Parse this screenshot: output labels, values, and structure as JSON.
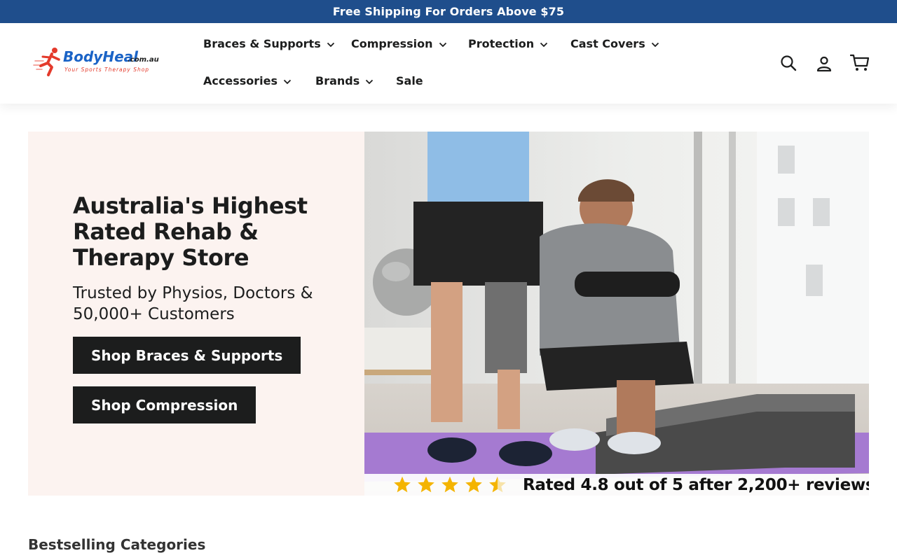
{
  "announcement": {
    "text": "Free Shipping For Orders Above $75"
  },
  "brand": {
    "name_main": "BodyHeal",
    "name_suffix": ".com.au",
    "tagline": "Your Sports Therapy Shop"
  },
  "nav": {
    "items": [
      {
        "label": "Braces & Supports",
        "has_dropdown": true
      },
      {
        "label": "Compression",
        "has_dropdown": true
      },
      {
        "label": "Protection",
        "has_dropdown": true
      },
      {
        "label": "Cast Covers",
        "has_dropdown": true
      },
      {
        "label": "Accessories",
        "has_dropdown": true
      },
      {
        "label": "Brands",
        "has_dropdown": true
      },
      {
        "label": "Sale",
        "has_dropdown": false
      }
    ]
  },
  "header_icons": [
    "search-icon",
    "account-icon",
    "cart-icon"
  ],
  "hero": {
    "title": "Australia's Highest Rated Rehab & Therapy Store",
    "subtitle": "Trusted by Physios, Doctors & 50,000+ Customers",
    "buttons": [
      {
        "label": "Shop Braces & Supports"
      },
      {
        "label": "Shop Compression"
      }
    ],
    "rating": {
      "stars": 4.5,
      "text": "Rated 4.8 out of 5 after 2,200+ reviews"
    }
  },
  "sections": {
    "bestselling_title": "Bestselling Categories"
  },
  "colors": {
    "announcement_bg": "#1f4e8c",
    "hero_bg": "#fcf3f0",
    "button_bg": "#1c1d1d",
    "star": "#f4b400",
    "logo_blue": "#1a63c6",
    "logo_red": "#e43a2b"
  }
}
